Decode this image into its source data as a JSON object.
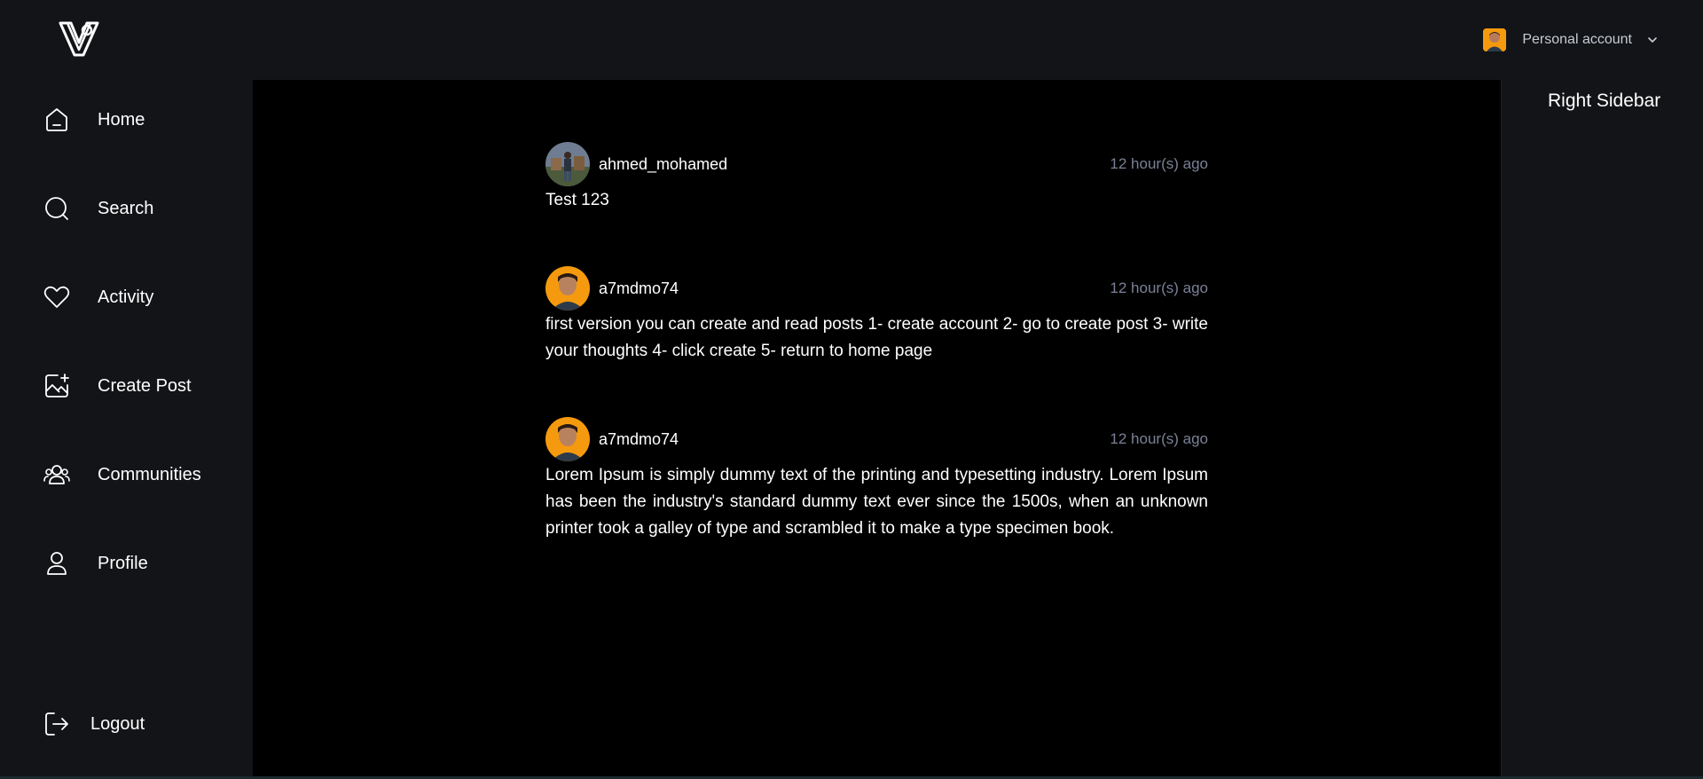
{
  "header": {
    "logo_icon": "brand-logo-icon",
    "account": {
      "label": "Personal account",
      "avatar_color": "#f59a0e"
    }
  },
  "sidebar": {
    "items": [
      {
        "label": "Home",
        "icon": "home-icon"
      },
      {
        "label": "Search",
        "icon": "search-icon"
      },
      {
        "label": "Activity",
        "icon": "heart-icon"
      },
      {
        "label": "Create Post",
        "icon": "image-plus-icon"
      },
      {
        "label": "Communities",
        "icon": "users-icon"
      },
      {
        "label": "Profile",
        "icon": "user-icon"
      }
    ],
    "logout": {
      "label": "Logout",
      "icon": "logout-icon"
    }
  },
  "right_sidebar": {
    "title": "Right Sidebar"
  },
  "feed": {
    "posts": [
      {
        "username": "ahmed_mohamed",
        "time": "12 hour(s) ago",
        "text": "Test 123"
      },
      {
        "username": "a7mdmo74",
        "time": "12 hour(s) ago",
        "text": "first version you can create and read posts 1- create account 2- go to create post 3- write your thoughts 4- click create 5- return to home page"
      },
      {
        "username": "a7mdmo74",
        "time": "12 hour(s) ago",
        "text": "Lorem Ipsum is simply dummy text of the printing and typesetting industry. Lorem Ipsum has been the industry's standard dummy text ever since the 1500s, when an unknown printer took a galley of type and scrambled it to make a type specimen book."
      }
    ]
  },
  "colors": {
    "panel_bg": "#121417",
    "main_bg": "#000000",
    "muted_text": "#7a8196",
    "avatar_orange": "#f59a0e"
  }
}
